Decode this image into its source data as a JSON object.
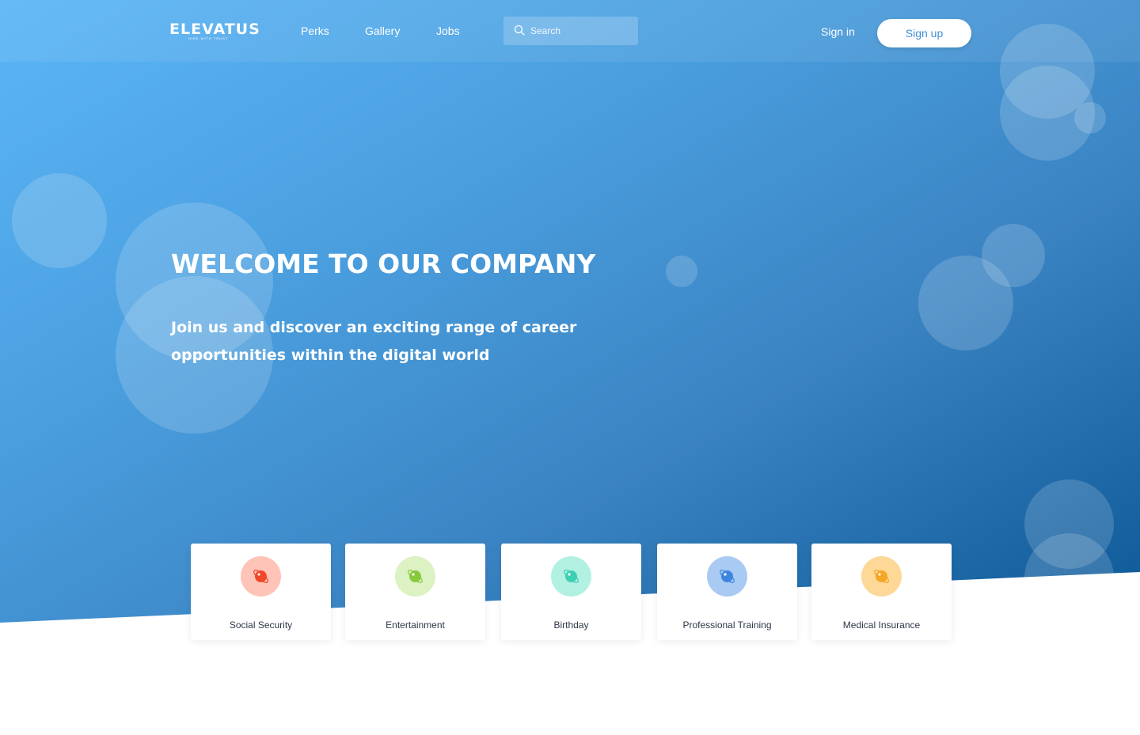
{
  "header": {
    "logo": {
      "name": "ELEVATUS",
      "tagline": "HIRE WITH TRUST"
    },
    "nav": [
      "Perks",
      "Gallery",
      "Jobs"
    ],
    "search": {
      "placeholder": "Search",
      "value": ""
    },
    "signin_label": "Sign in",
    "signup_label": "Sign up"
  },
  "hero": {
    "title": "WELCOME TO OUR COMPANY",
    "subtitle": "Join us and discover an exciting range of career opportunities within the digital world"
  },
  "perks": [
    {
      "label": "Social Security",
      "icon": "planet-icon",
      "bg_color": "#ffc4b8",
      "icon_color": "#f0462a"
    },
    {
      "label": "Entertainment",
      "icon": "planet-icon",
      "bg_color": "#dcf2c2",
      "icon_color": "#86c93c"
    },
    {
      "label": "Birthday",
      "icon": "planet-icon",
      "bg_color": "#b2f1e2",
      "icon_color": "#3ecfb3"
    },
    {
      "label": "Professional Training",
      "icon": "planet-icon",
      "bg_color": "#a9caf2",
      "icon_color": "#3d86e0"
    },
    {
      "label": "Medical Insurance",
      "icon": "planet-icon",
      "bg_color": "#fdd897",
      "icon_color": "#f4a725"
    }
  ],
  "colors": {
    "brand_blue": "#3f8fd6",
    "hero_gradient_start": "#5bb6f6",
    "hero_gradient_end": "#0b5796",
    "card_text": "#2d3748"
  }
}
